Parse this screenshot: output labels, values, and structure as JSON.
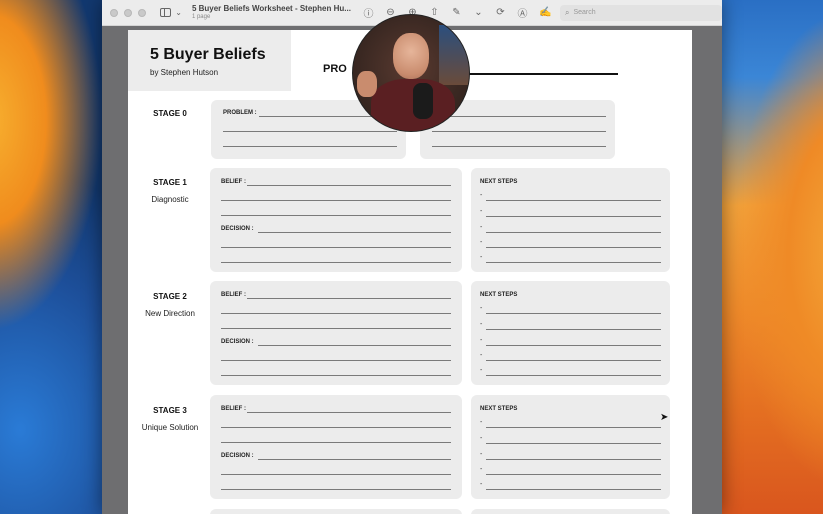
{
  "window": {
    "title": "5 Buyer Beliefs Worksheet - Stephen Hu...",
    "subtitle": "1 page",
    "search_placeholder": "Search",
    "toolbar_icons": [
      "info-icon",
      "zoom-out-icon",
      "zoom-in-icon",
      "share-icon",
      "markup-pen-icon",
      "rotate-icon",
      "highlight-icon",
      "signature-icon"
    ]
  },
  "doc": {
    "brand_title": "5 Buyer Beliefs",
    "brand_author": "by Stephen Hutson",
    "problem_heading": "PRO",
    "stage0": {
      "name": "STAGE 0",
      "field": "PROBLEM :"
    },
    "stages": [
      {
        "name": "STAGE 1",
        "desc": "Diagnostic",
        "belief": "BELIEF :",
        "decision": "DECISION :",
        "next": "NEXT STEPS"
      },
      {
        "name": "STAGE 2",
        "desc": "New Direction",
        "belief": "BELIEF :",
        "decision": "DECISION :",
        "next": "NEXT STEPS"
      },
      {
        "name": "STAGE 3",
        "desc": "Unique Solution",
        "belief": "BELIEF :",
        "decision": "DECISION :",
        "next": "NEXT STEPS"
      }
    ],
    "bullet": "-"
  }
}
